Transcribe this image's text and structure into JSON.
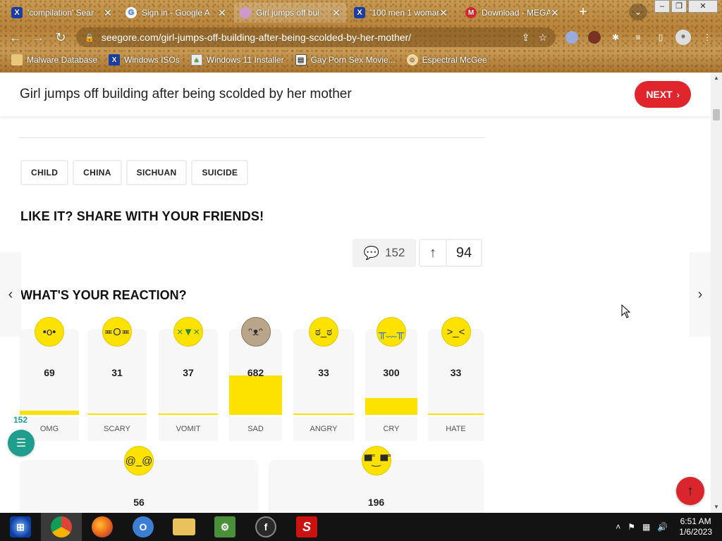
{
  "browser": {
    "tabs": [
      {
        "title": "'compilation' Sear",
        "favicon": "x-icon"
      },
      {
        "title": "Sign in - Google A",
        "favicon": "google-icon"
      },
      {
        "title": "Girl jumps off bui",
        "favicon": "seegore-icon"
      },
      {
        "title": "'100 men 1 woman",
        "favicon": "x-icon"
      },
      {
        "title": "Download - MEGA",
        "favicon": "mega-icon"
      }
    ],
    "active_tab": 2,
    "url": "seegore.com/girl-jumps-off-building-after-being-scolded-by-her-mother/",
    "bookmarks": [
      {
        "label": "Malware Database",
        "icon": "malware-icon"
      },
      {
        "label": "Windows ISOs",
        "icon": "x-icon"
      },
      {
        "label": "Windows 11 Installer",
        "icon": "image-icon"
      },
      {
        "label": "Gay Porn Sex Movie...",
        "icon": "document-icon"
      },
      {
        "label": "Espectral McGee",
        "icon": "face-icon"
      }
    ]
  },
  "page": {
    "title": "Girl jumps off building after being scolded by her mother",
    "next_label": "NEXT",
    "tags": [
      "CHILD",
      "CHINA",
      "SICHUAN",
      "SUICIDE"
    ],
    "share_heading": "LIKE IT? SHARE WITH YOUR FRIENDS!",
    "comments_count": "152",
    "votes_count": "94",
    "reaction_heading": "WHAT'S YOUR REACTION?",
    "reactions": [
      {
        "label": "OMG",
        "count": "69",
        "fill_fraction": 0.05
      },
      {
        "label": "SCARY",
        "count": "31",
        "fill_fraction": 0.02
      },
      {
        "label": "VOMIT",
        "count": "37",
        "fill_fraction": 0.02
      },
      {
        "label": "SAD",
        "count": "682",
        "fill_fraction": 0.46
      },
      {
        "label": "ANGRY",
        "count": "33",
        "fill_fraction": 0.02
      },
      {
        "label": "CRY",
        "count": "300",
        "fill_fraction": 0.2
      },
      {
        "label": "HATE",
        "count": "33",
        "fill_fraction": 0.02
      }
    ],
    "reactions_row2": [
      {
        "count": "56"
      },
      {
        "count": "196"
      }
    ],
    "floating_comments_count": "152"
  },
  "taskbar": {
    "time": "6:51 AM",
    "date": "1/6/2023"
  },
  "colors": {
    "accent_red": "#e0252c",
    "reaction_yellow": "#fde200",
    "teal": "#1f9e8e"
  }
}
